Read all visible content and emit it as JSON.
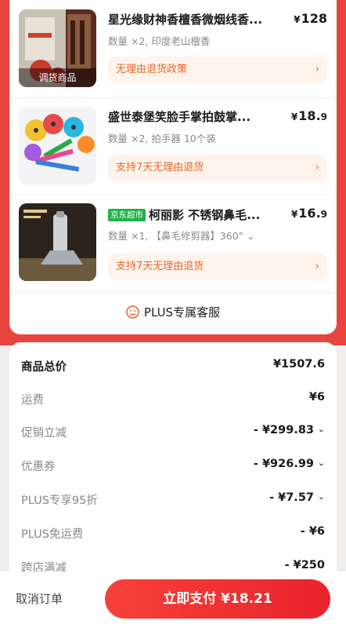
{
  "items": [
    {
      "title": "星光缘财神香檀香微烟线香...",
      "price_int": "128",
      "price_dec": "",
      "spec": "数量 ×2, 印度老山檀香",
      "policy": "无理由退货政策",
      "thumb_tag": "调货商品",
      "badge": ""
    },
    {
      "title": "盛世泰堡笑脸手掌拍鼓掌...",
      "price_int": "18.",
      "price_dec": "9",
      "spec": "数量 ×2, 拍手器 10个装",
      "policy": "支持7天无理由退货",
      "thumb_tag": "",
      "badge": ""
    },
    {
      "title": "柯丽影 不锈钢鼻毛...",
      "price_int": "16.",
      "price_dec": "9",
      "spec": "数量 ×1, 【鼻毛修剪器】360°",
      "policy": "支持7天无理由退货",
      "thumb_tag": "",
      "badge": "京东超市"
    }
  ],
  "currency_symbol": "¥",
  "chevron_right": "›",
  "spec_caret": "⌄",
  "service_label": "PLUS专属客服",
  "summary": [
    {
      "label": "商品总价",
      "value": "¥1507.6",
      "arrow": false
    },
    {
      "label": "运费",
      "value": "¥6",
      "arrow": false
    },
    {
      "label": "促销立减",
      "value": "- ¥299.83",
      "arrow": true
    },
    {
      "label": "优惠券",
      "value": "- ¥926.99",
      "arrow": true
    },
    {
      "label": "PLUS专享95折",
      "value": "- ¥7.57",
      "arrow": true
    },
    {
      "label": "PLUS免运费",
      "value": "- ¥6",
      "arrow": false
    },
    {
      "label": "跨店满减",
      "value": "- ¥250",
      "arrow": false
    }
  ],
  "footer": {
    "cancel_label": "取消订单",
    "pay_label": "立即支付 ¥18.21"
  },
  "colors": {
    "brand_red": "#e8443e",
    "policy_orange": "#e8662a",
    "jd_green": "#1fb34a"
  }
}
